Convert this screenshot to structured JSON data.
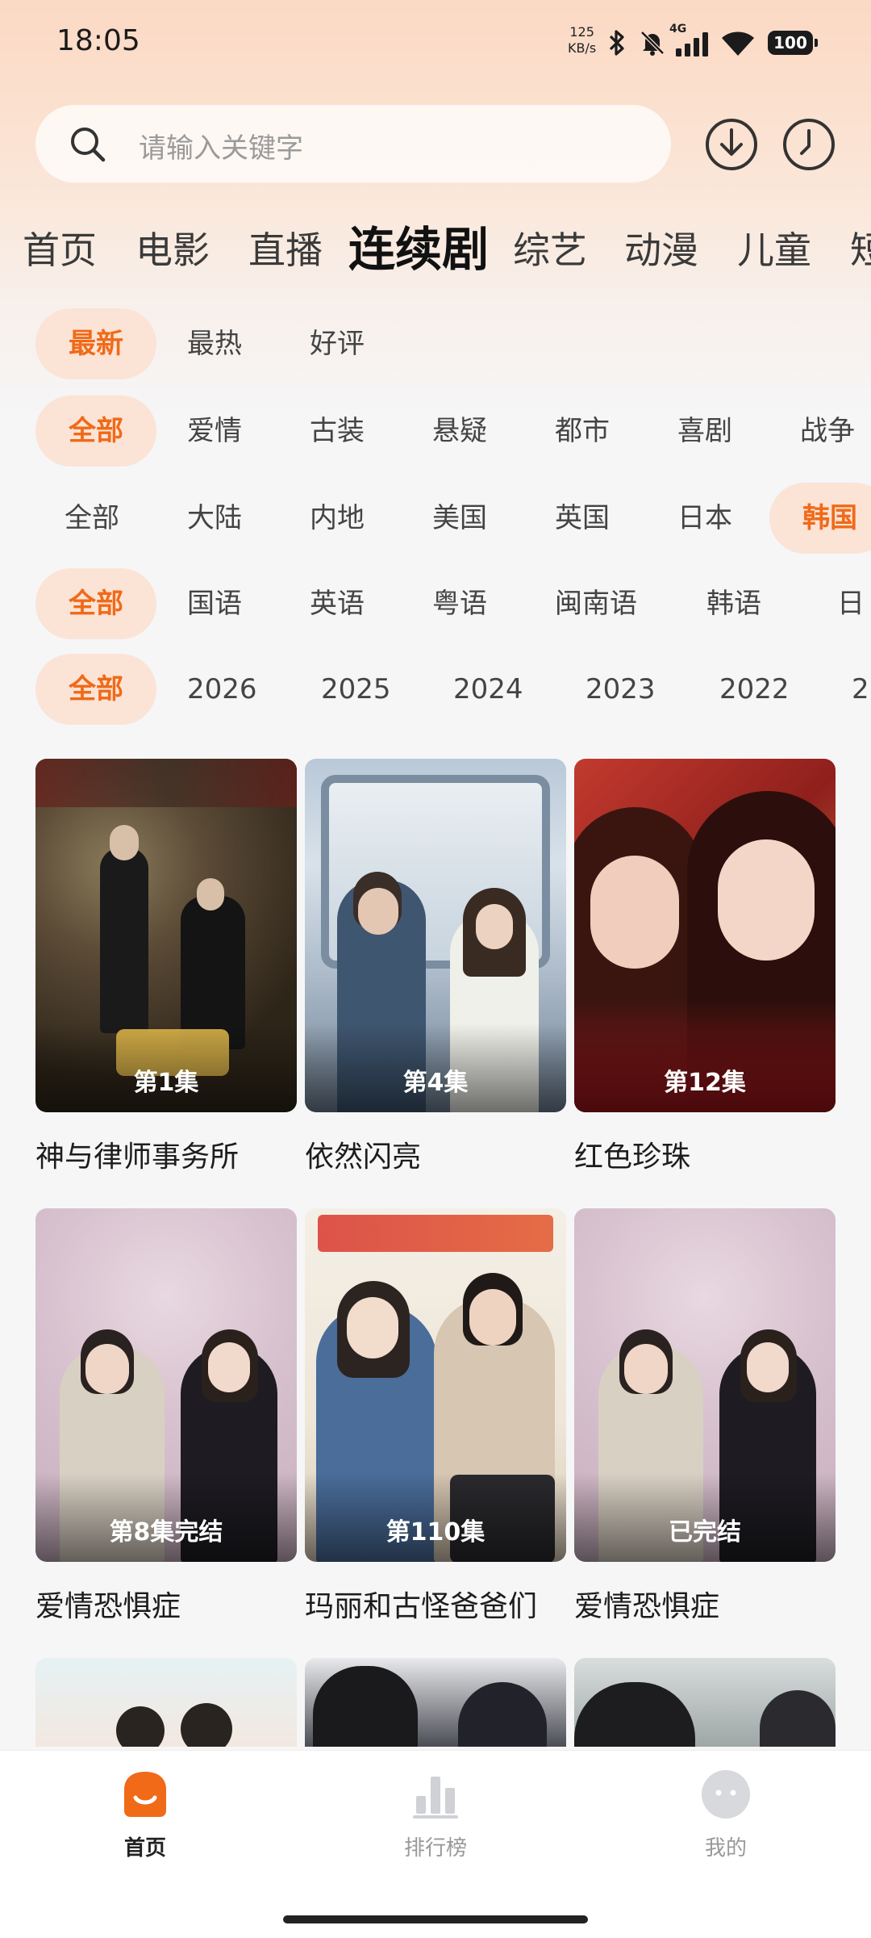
{
  "status_bar": {
    "time": "18:05",
    "speed_value": "125",
    "speed_unit": "KB/s",
    "network": "4G",
    "battery": "100"
  },
  "search": {
    "placeholder": "请输入关键字"
  },
  "categories": [
    "首页",
    "电影",
    "直播",
    "连续剧",
    "综艺",
    "动漫",
    "儿童",
    "短"
  ],
  "categories_active": "连续剧",
  "filters": {
    "sort": [
      "最新",
      "最热",
      "好评"
    ],
    "genre": [
      "全部",
      "爱情",
      "古装",
      "悬疑",
      "都市",
      "喜剧",
      "战争"
    ],
    "region": [
      "全部",
      "大陆",
      "内地",
      "美国",
      "英国",
      "日本",
      "韩国"
    ],
    "language": [
      "全部",
      "国语",
      "英语",
      "粤语",
      "闽南语",
      "韩语",
      "日语"
    ],
    "year": [
      "全部",
      "2026",
      "2025",
      "2024",
      "2023",
      "2022",
      "2"
    ]
  },
  "filters_active": {
    "sort": "最新",
    "genre": "全部",
    "region": "韩国",
    "language": "全部",
    "year": "全部"
  },
  "shows": [
    {
      "title": "神与律师事务所",
      "badge": "第1集"
    },
    {
      "title": "依然闪亮",
      "badge": "第4集"
    },
    {
      "title": "红色珍珠",
      "badge": "第12集"
    },
    {
      "title": "爱情恐惧症",
      "badge": "第8集完结"
    },
    {
      "title": "玛丽和古怪爸爸们",
      "badge": "第110集"
    },
    {
      "title": "爱情恐惧症",
      "badge": "已完结"
    }
  ],
  "bottom_nav": [
    {
      "label": "首页",
      "icon": "home-icon"
    },
    {
      "label": "排行榜",
      "icon": "ranking-icon"
    },
    {
      "label": "我的",
      "icon": "profile-icon"
    }
  ],
  "colors": {
    "accent": "#f06a18",
    "chip_bg": "#fbe3d6"
  }
}
